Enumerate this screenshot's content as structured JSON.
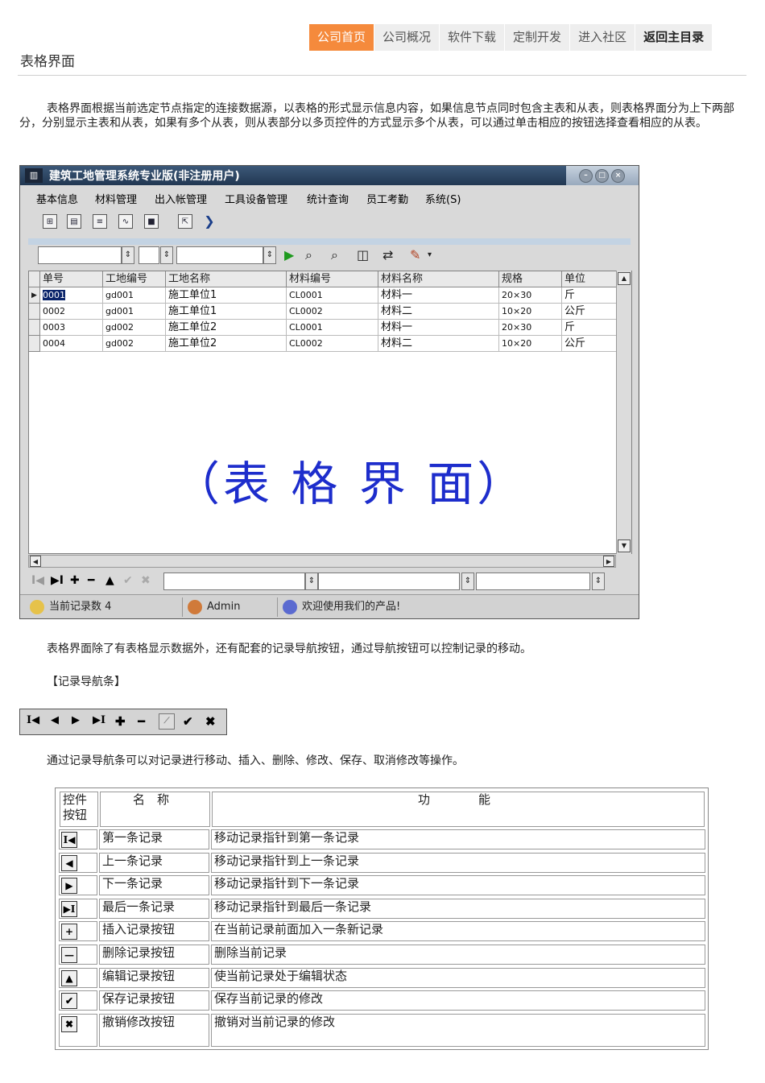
{
  "nav": {
    "items": [
      "公司首页",
      "公司概况",
      "软件下载",
      "定制开发",
      "进入社区",
      "返回主目录"
    ]
  },
  "page_title": "表格界面",
  "intro_text": "表格界面根据当前选定节点指定的连接数据源，以表格的形式显示信息内容，如果信息节点同时包含主表和从表，则表格界面分为上下两部分，分别显示主表和从表，如果有多个从表，则从表部分以多页控件的方式显示多个从表，可以通过单击相应的按钮选择查看相应的从表。",
  "app": {
    "title": "建筑工地管理系统专业版(非注册用户)",
    "menu": [
      "基本信息",
      "材料管理",
      "出入帐管理",
      "工具设备管理",
      "统计查询",
      "员工考勤",
      "系统(S)"
    ],
    "grid": {
      "columns": [
        "单号",
        "工地编号",
        "工地名称",
        "材料编号",
        "材料名称",
        "规格",
        "单位"
      ],
      "rows": [
        [
          "0001",
          "gd001",
          "施工单位1",
          "CL0001",
          "材料一",
          "20×30",
          "斤"
        ],
        [
          "0002",
          "gd001",
          "施工单位1",
          "CL0002",
          "材料二",
          "10×20",
          "公斤"
        ],
        [
          "0003",
          "gd002",
          "施工单位2",
          "CL0001",
          "材料一",
          "20×30",
          "斤"
        ],
        [
          "0004",
          "gd002",
          "施工单位2",
          "CL0002",
          "材料二",
          "10×20",
          "公斤"
        ]
      ]
    },
    "watermark": "（表 格 界 面）",
    "status": {
      "record_count": "当前记录数 4",
      "user": "Admin",
      "welcome": "欢迎使用我们的产品!"
    }
  },
  "para2": "表格界面除了有表格显示数据外，还有配套的记录导航按钮，通过导航按钮可以控制记录的移动。",
  "nav_heading": "【记录导航条】",
  "para3": "通过记录导航条可以对记录进行移动、插入、删除、修改、保存、取消修改等操作。",
  "table": {
    "headers": [
      "控件按钮",
      "名　称",
      "功　　　　能"
    ],
    "rows": [
      {
        "icon": "first-record-icon",
        "glyph": "I◀",
        "name": "第一条记录",
        "func": "移动记录指针到第一条记录"
      },
      {
        "icon": "prior-record-icon",
        "glyph": "◀",
        "name": "上一条记录",
        "func": "移动记录指针到上一条记录"
      },
      {
        "icon": "next-record-icon",
        "glyph": "▶",
        "name": "下一条记录",
        "func": "移动记录指针到下一条记录"
      },
      {
        "icon": "last-record-icon",
        "glyph": "▶I",
        "name": "最后一条记录",
        "func": "移动记录指针到最后一条记录"
      },
      {
        "icon": "insert-record-icon",
        "glyph": "+",
        "name": "插入记录按钮",
        "func": "在当前记录前面加入一条新记录"
      },
      {
        "icon": "delete-record-icon",
        "glyph": "—",
        "name": "删除记录按钮",
        "func": "删除当前记录"
      },
      {
        "icon": "edit-record-icon",
        "glyph": "▲",
        "name": "编辑记录按钮",
        "func": "使当前记录处于编辑状态"
      },
      {
        "icon": "save-record-icon",
        "glyph": "✔",
        "name": "保存记录按钮",
        "func": "保存当前记录的修改"
      },
      {
        "icon": "cancel-record-icon",
        "glyph": "✖",
        "name": "撤销修改按钮",
        "func": "撤销对当前记录的修改"
      }
    ]
  }
}
